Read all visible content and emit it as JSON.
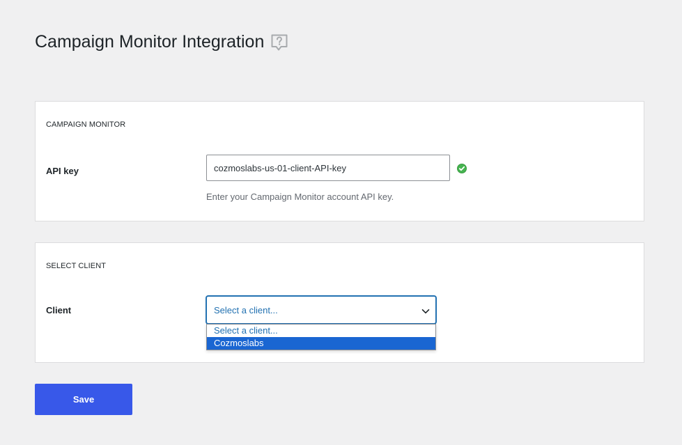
{
  "page": {
    "title": "Campaign Monitor Integration"
  },
  "api_section": {
    "heading": "CAMPAIGN MONITOR",
    "label": "API key",
    "value": "cozmoslabs-us-01-client-API-key",
    "help": "Enter your Campaign Monitor account API key."
  },
  "client_section": {
    "heading": "SELECT CLIENT",
    "label": "Client",
    "selected": "Select a client...",
    "options": [
      {
        "label": "Select a client..."
      },
      {
        "label": "Cozmoslabs"
      }
    ]
  },
  "actions": {
    "save_label": "Save"
  },
  "colors": {
    "accent": "#3858e9",
    "valid": "#46b450",
    "link": "#2271b1",
    "highlight": "#1a66d2"
  }
}
